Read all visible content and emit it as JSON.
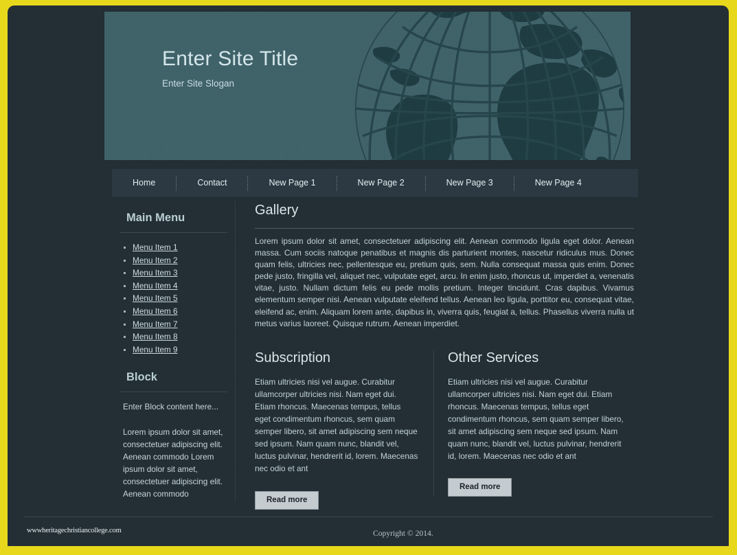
{
  "site": {
    "title": "Enter Site Title",
    "slogan": "Enter Site Slogan",
    "banner_graphic": "globe-graphic",
    "banner_bg_color": "#3f6269",
    "page_bg_color": "#232e35",
    "frame_color": "#e8d81c"
  },
  "nav": {
    "items": [
      {
        "label": "Home"
      },
      {
        "label": "Contact"
      },
      {
        "label": "New Page 1"
      },
      {
        "label": "New Page 2"
      },
      {
        "label": "New Page 3"
      },
      {
        "label": "New Page 4"
      }
    ]
  },
  "sidebar": {
    "main_menu": {
      "heading": "Main Menu",
      "items": [
        {
          "label": "Menu Item 1"
        },
        {
          "label": "Menu Item 2"
        },
        {
          "label": "Menu Item 3"
        },
        {
          "label": "Menu Item 4"
        },
        {
          "label": "Menu Item 5"
        },
        {
          "label": "Menu Item 6"
        },
        {
          "label": "Menu Item 7"
        },
        {
          "label": "Menu Item 8"
        },
        {
          "label": "Menu Item 9"
        }
      ]
    },
    "block": {
      "heading": "Block",
      "intro": "Enter Block content here...",
      "paragraph": "Lorem ipsum dolor sit amet, consectetuer adipiscing elit. Aenean commodo Lorem ipsum dolor sit amet, consectetuer adipiscing elit. Aenean commodo"
    }
  },
  "main": {
    "gallery": {
      "heading": "Gallery",
      "text": "Lorem ipsum dolor sit amet, consectetuer adipiscing elit. Aenean commodo ligula eget dolor. Aenean massa. Cum sociis natoque penatibus et magnis dis parturient montes, nascetur ridiculus mus. Donec quam felis, ultricies nec, pellentesque eu, pretium quis, sem. Nulla consequat massa quis enim. Donec pede justo, fringilla vel, aliquet nec, vulputate eget, arcu. In enim justo, rhoncus ut, imperdiet a, venenatis vitae, justo. Nullam dictum felis eu pede mollis pretium. Integer tincidunt. Cras dapibus. Vivamus elementum semper nisi. Aenean vulputate eleifend tellus. Aenean leo ligula, porttitor eu, consequat vitae, eleifend ac, enim. Aliquam lorem ante, dapibus in, viverra quis, feugiat a, tellus. Phasellus viverra nulla ut metus varius laoreet. Quisque rutrum. Aenean imperdiet."
    },
    "columns": [
      {
        "heading": "Subscription",
        "text": "Etiam ultricies nisi vel augue. Curabitur ullamcorper ultricies nisi. Nam eget dui. Etiam rhoncus. Maecenas tempus, tellus eget condimentum rhoncus, sem quam semper libero, sit amet adipiscing sem neque sed ipsum. Nam quam nunc, blandit vel, luctus pulvinar, hendrerit id, lorem. Maecenas nec odio et ant",
        "button_label": "Read more"
      },
      {
        "heading": "Other Services",
        "text": "Etiam ultricies nisi vel augue. Curabitur ullamcorper ultricies nisi. Nam eget dui. Etiam rhoncus. Maecenas tempus, tellus eget condimentum rhoncus, sem quam semper libero, sit amet adipiscing sem neque sed ipsum. Nam quam nunc, blandit vel, luctus pulvinar, hendrerit id, lorem. Maecenas nec odio et ant",
        "button_label": "Read more"
      }
    ]
  },
  "footer": {
    "watermark": "wwwheritagechristiancollege.com",
    "copyright": "Copyright © 2014."
  }
}
